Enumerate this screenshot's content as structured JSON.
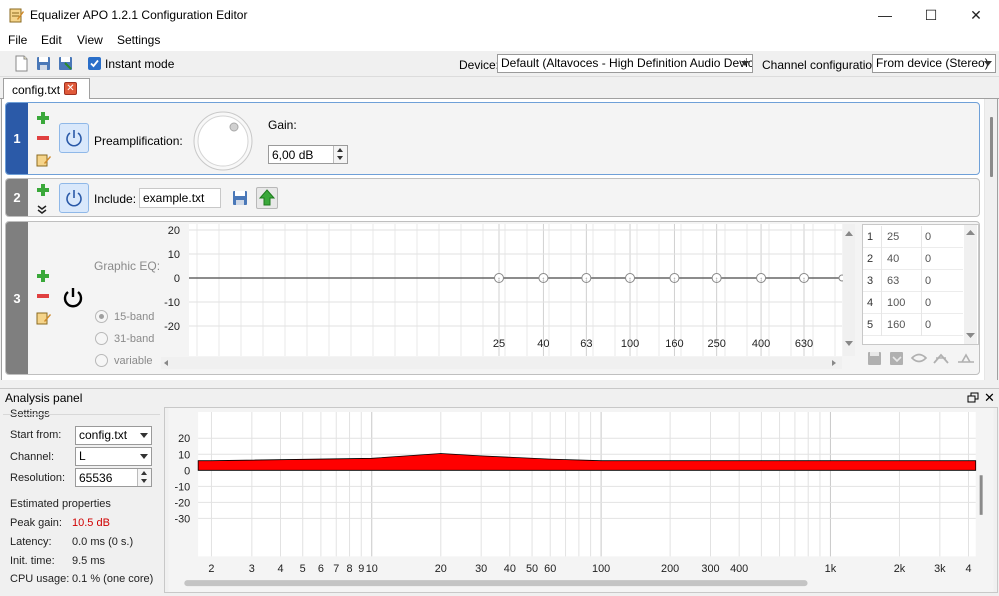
{
  "window": {
    "title": "Equalizer APO 1.2.1 Configuration Editor",
    "minimize": "—",
    "maximize": "☐",
    "close": "✕"
  },
  "menu": [
    "File",
    "Edit",
    "View",
    "Settings"
  ],
  "toolbar": {
    "instant_mode_label": "Instant mode",
    "instant_mode_checked": true,
    "device_label": "Device:",
    "device_value": "Default (Altavoces - High Definition Audio Device)",
    "channel_config_label": "Channel configuration:",
    "channel_config_value": "From device (Stereo)"
  },
  "tabs": [
    {
      "label": "config.txt"
    }
  ],
  "filters": {
    "f1": {
      "number": "1",
      "label": "Preamplification:",
      "gain_label": "Gain:",
      "gain_value": "6,00 dB",
      "knob_level": 0.6
    },
    "f2": {
      "number": "2",
      "label": "Include:",
      "file_value": "example.txt"
    },
    "f3": {
      "number": "3",
      "label": "Graphic EQ:",
      "options": [
        "15-band",
        "31-band",
        "variable"
      ],
      "selected": "15-band",
      "y_ticks": [
        "20",
        "10",
        "0",
        "-10",
        "-20"
      ],
      "x_ticks": [
        "25",
        "40",
        "63",
        "100",
        "160",
        "250",
        "400",
        "630"
      ],
      "table": [
        {
          "n": "1",
          "freq": "25",
          "gain": "0"
        },
        {
          "n": "2",
          "freq": "40",
          "gain": "0"
        },
        {
          "n": "3",
          "freq": "63",
          "gain": "0"
        },
        {
          "n": "4",
          "freq": "100",
          "gain": "0"
        },
        {
          "n": "5",
          "freq": "160",
          "gain": "0"
        }
      ]
    }
  },
  "analysis": {
    "title": "Analysis panel",
    "settings_title": "Settings",
    "start_from_label": "Start from:",
    "start_from_value": "config.txt",
    "channel_label": "Channel:",
    "channel_value": "L",
    "resolution_label": "Resolution:",
    "resolution_value": "65536",
    "estimated_title": "Estimated properties",
    "peak_gain_label": "Peak gain:",
    "peak_gain_value": "10.5 dB",
    "latency_label": "Latency:",
    "latency_value": "0.0 ms (0 s.)",
    "init_time_label": "Init. time:",
    "init_time_value": "9.5 ms",
    "cpu_label": "CPU usage:",
    "cpu_value": "0.1 % (one core)",
    "y_ticks": [
      "20",
      "10",
      "0",
      "-10",
      "-20",
      "-30"
    ],
    "x_ticks": [
      "2",
      "3",
      "4",
      "5",
      "6",
      "7",
      "8",
      "9",
      "10",
      "20",
      "30",
      "40",
      "50",
      "60",
      "100",
      "200",
      "300",
      "400",
      "1k",
      "2k",
      "3k",
      "4"
    ],
    "fill_color": "#ff0000"
  },
  "chart_data": {
    "type": "area",
    "x": [
      2,
      10,
      20,
      30,
      60,
      100,
      200,
      400,
      1000,
      4000
    ],
    "series": [
      {
        "name": "",
        "upper": [
          6,
          7.5,
          10.5,
          9,
          7,
          6,
          6,
          6,
          6,
          6
        ],
        "lower": [
          0,
          0,
          0,
          0,
          0,
          0,
          0,
          0,
          0,
          0
        ]
      }
    ],
    "ylim": [
      -35,
      22
    ],
    "xscale": "log"
  }
}
